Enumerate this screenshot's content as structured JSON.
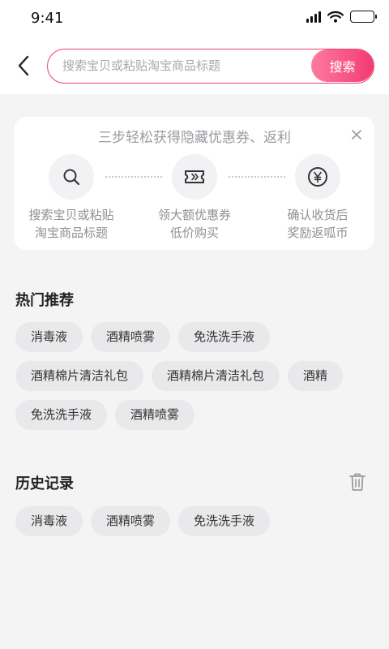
{
  "status_bar": {
    "time": "9:41"
  },
  "search": {
    "placeholder": "搜索宝贝或粘贴淘宝商品标题",
    "button_label": "搜索"
  },
  "steps_card": {
    "title": "三步轻松获得隐藏优惠券、返利",
    "steps": [
      {
        "icon": "search-icon",
        "line1": "搜索宝贝或粘贴",
        "line2": "淘宝商品标题"
      },
      {
        "icon": "coupon-ticket-icon",
        "line1": "领大额优惠券",
        "line2": "低价购买"
      },
      {
        "icon": "yen-coin-icon",
        "line1": "确认收货后",
        "line2": "奖励返呱币"
      }
    ]
  },
  "hot": {
    "title": "热门推荐",
    "rows": [
      [
        "消毒液",
        "酒精喷雾",
        "免洗洗手液"
      ],
      [
        "酒精棉片清洁礼包",
        "酒精棉片清洁礼包",
        "酒精"
      ],
      [
        "免洗洗手液",
        "酒精喷雾"
      ]
    ]
  },
  "history": {
    "title": "历史记录",
    "tags": [
      "消毒液",
      "酒精喷雾",
      "免洗洗手液"
    ]
  },
  "colors": {
    "accent": "#f23b70",
    "accent_light": "#ff7aa0",
    "page_bg": "#f4f4f5",
    "tag_bg": "#e9e9eb"
  }
}
